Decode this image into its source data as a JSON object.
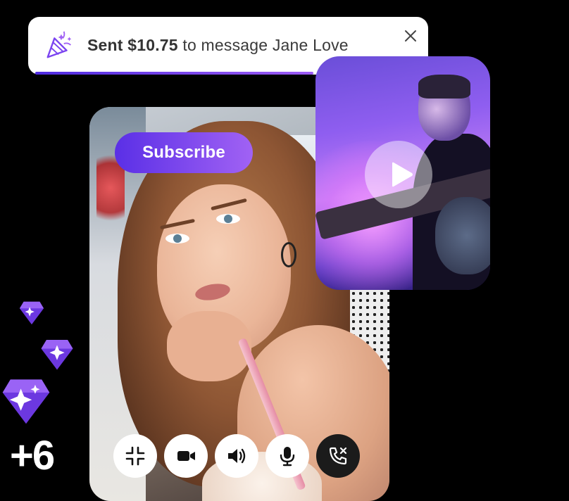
{
  "notification": {
    "amount": "Sent $10.75",
    "message": " to message Jane Love",
    "progress": 0.72,
    "icon": "party-popper-icon",
    "accent": "#7b44f0"
  },
  "photo": {
    "subscribe_label": "Subscribe"
  },
  "call_controls": [
    {
      "name": "minimize-button",
      "icon": "minimize-icon"
    },
    {
      "name": "video-button",
      "icon": "video-camera-icon"
    },
    {
      "name": "speaker-button",
      "icon": "speaker-icon"
    },
    {
      "name": "microphone-button",
      "icon": "microphone-icon"
    },
    {
      "name": "end-call-button",
      "icon": "phone-hangup-icon"
    }
  ],
  "video": {
    "icon": "play-icon"
  },
  "decoration": {
    "count_label": "+6",
    "gem_color": "#8b4df2"
  }
}
